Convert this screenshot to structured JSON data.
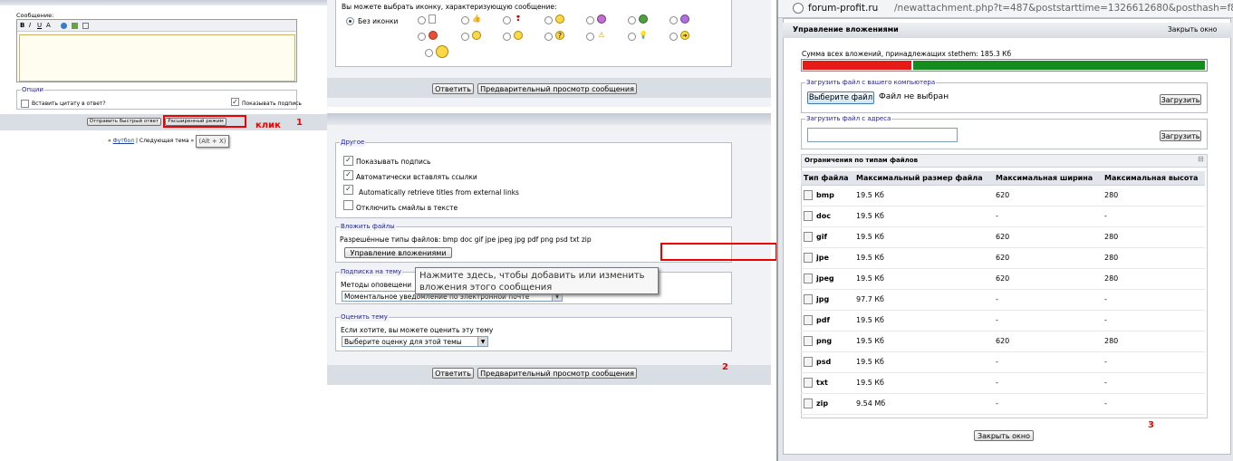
{
  "panel1": {
    "message_label": "Сообщение:",
    "options_legend": "Опции",
    "quote_label": "Вставить цитату в ответ?",
    "show_signature_label": "Показывать подпись",
    "quick_reply_button": "Отправить быстрый ответ",
    "advanced_mode_button": "Расширенный режим",
    "click_annotation": "клик",
    "step_number": "1",
    "breadcrumb_prefix": "«",
    "breadcrumb_link": "Футбол",
    "breadcrumb_sep": "|",
    "breadcrumb_next": "Следующая тема »",
    "tooltip": "(Alt + X)"
  },
  "panel2": {
    "icon_prompt": "Вы можете выбрать иконку, характеризующую сообщение:",
    "no_icon_label": "Без иконки",
    "reply_button": "Ответить",
    "preview_button": "Предварительный просмотр сообщения",
    "other_legend": "Другое",
    "opt_show_signature": "Показывать подпись",
    "opt_auto_links": "Автоматически вставлять ссылки",
    "opt_retrieve_titles": "Automatically retrieve titles from external links",
    "opt_disable_smilies": "Отключить смайлы в тексте",
    "attach_legend": "Вложить файлы",
    "allowed_types": "Разрешённые типы файлов: bmp doc gif jpe jpeg jpg pdf png psd txt zip",
    "manage_attachments_button": "Управление вложениями",
    "subscribe_legend": "Подписка на тему",
    "notify_label": "Методы оповещени",
    "notify_value": "Моментальное уведомление по электронной почте",
    "tooltip": "Нажмите здесь, чтобы добавить или изменить вложения этого сообщения",
    "rate_legend": "Оценить тему",
    "rate_prompt": "Если хотите, вы можете оценить эту тему",
    "rate_select": "Выберите оценку для этой темы",
    "reply_button_bottom": "Ответить",
    "preview_button_bottom": "Предварительный просмотр сообщения",
    "step_number": "2"
  },
  "panel3": {
    "url_domain": "forum-profit.ru",
    "url_path": "/newattachment.php?t=487&poststarttime=1326612680&posthash=f8",
    "title": "Управление вложениями",
    "close_link": "Закрыть окно",
    "total_label": "Сумма всех вложений, принадлежащих stethem: 185.3 Кб",
    "usage_fraction": 0.27,
    "upload_computer_legend": "Загрузить файл с вашего компьютера",
    "choose_file_button": "Выберите файл",
    "no_file_text": "Файл не выбран",
    "upload_button_1": "Загрузить",
    "upload_url_legend": "Загрузить файл с адреса",
    "upload_button_2": "Загрузить",
    "limits_title": "Ограничения по типам файлов",
    "limits_collapse": "⊟",
    "columns": [
      "Тип файла",
      "Максимальный размер файла",
      "Максимальная ширина",
      "Максимальная высота"
    ],
    "rows": [
      {
        "ext": "bmp",
        "size": "19.5 Кб",
        "width": "620",
        "height": "280"
      },
      {
        "ext": "doc",
        "size": "19.5 Кб",
        "width": "-",
        "height": "-"
      },
      {
        "ext": "gif",
        "size": "19.5 Кб",
        "width": "620",
        "height": "280"
      },
      {
        "ext": "jpe",
        "size": "19.5 Кб",
        "width": "620",
        "height": "280"
      },
      {
        "ext": "jpeg",
        "size": "19.5 Кб",
        "width": "620",
        "height": "280"
      },
      {
        "ext": "jpg",
        "size": "97.7 Кб",
        "width": "-",
        "height": "-"
      },
      {
        "ext": "pdf",
        "size": "19.5 Кб",
        "width": "-",
        "height": "-"
      },
      {
        "ext": "png",
        "size": "19.5 Кб",
        "width": "620",
        "height": "280"
      },
      {
        "ext": "psd",
        "size": "19.5 Кб",
        "width": "-",
        "height": "-"
      },
      {
        "ext": "txt",
        "size": "19.5 Кб",
        "width": "-",
        "height": "-"
      },
      {
        "ext": "zip",
        "size": "9.54 Мб",
        "width": "-",
        "height": "-"
      }
    ],
    "step_number": "3",
    "close_button": "Закрыть окно"
  },
  "colors": {
    "red_annotation": "#e00000",
    "bar_used": "#e41b17",
    "bar_free": "#158c1d",
    "header_bg": "#dfe4ec",
    "link": "#1b3fa6"
  }
}
